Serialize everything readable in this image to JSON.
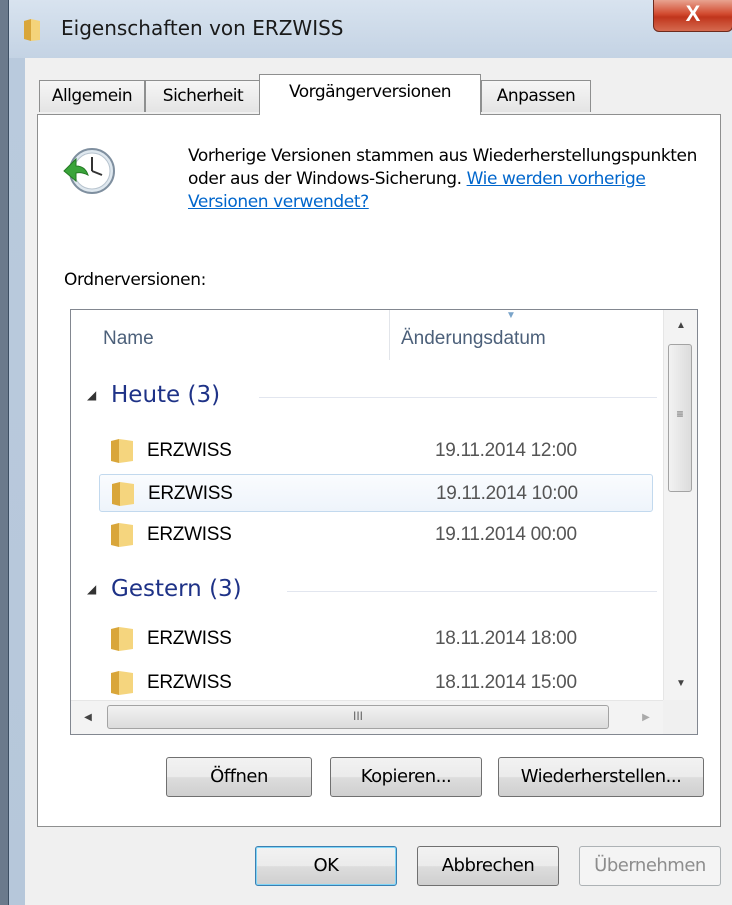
{
  "window": {
    "title": "Eigenschaften von ERZWISS",
    "close_label": "X"
  },
  "tabs": [
    {
      "label": "Allgemein",
      "active": false
    },
    {
      "label": "Sicherheit",
      "active": false
    },
    {
      "label": "Vorgängerversionen",
      "active": true
    },
    {
      "label": "Anpassen",
      "active": false
    }
  ],
  "info": {
    "text": "Vorherige Versionen stammen aus Wiederherstellungspunkten oder aus der Windows-Sicherung. ",
    "link": "Wie werden vorherige Versionen verwendet?"
  },
  "versions_label": "Ordnerversionen:",
  "list": {
    "columns": {
      "name": "Name",
      "date": "Änderungsdatum"
    },
    "groups": [
      {
        "title": "Heute (3)",
        "rows": [
          {
            "name": "ERZWISS",
            "date": "19.11.2014 12:00",
            "selected": false
          },
          {
            "name": "ERZWISS",
            "date": "19.11.2014 10:00",
            "selected": true
          },
          {
            "name": "ERZWISS",
            "date": "19.11.2014 00:00",
            "selected": false
          }
        ]
      },
      {
        "title": "Gestern (3)",
        "rows": [
          {
            "name": "ERZWISS",
            "date": "18.11.2014 18:00",
            "selected": false
          },
          {
            "name": "ERZWISS",
            "date": "18.11.2014 15:00",
            "selected": false
          }
        ]
      }
    ]
  },
  "actions": {
    "open": "Öffnen",
    "copy": "Kopieren...",
    "restore": "Wiederherstellen..."
  },
  "footer": {
    "ok": "OK",
    "cancel": "Abbrechen",
    "apply": "Übernehmen"
  },
  "colors": {
    "link": "#0066cc",
    "group_title": "#1e3287",
    "close": "#c0351c"
  }
}
